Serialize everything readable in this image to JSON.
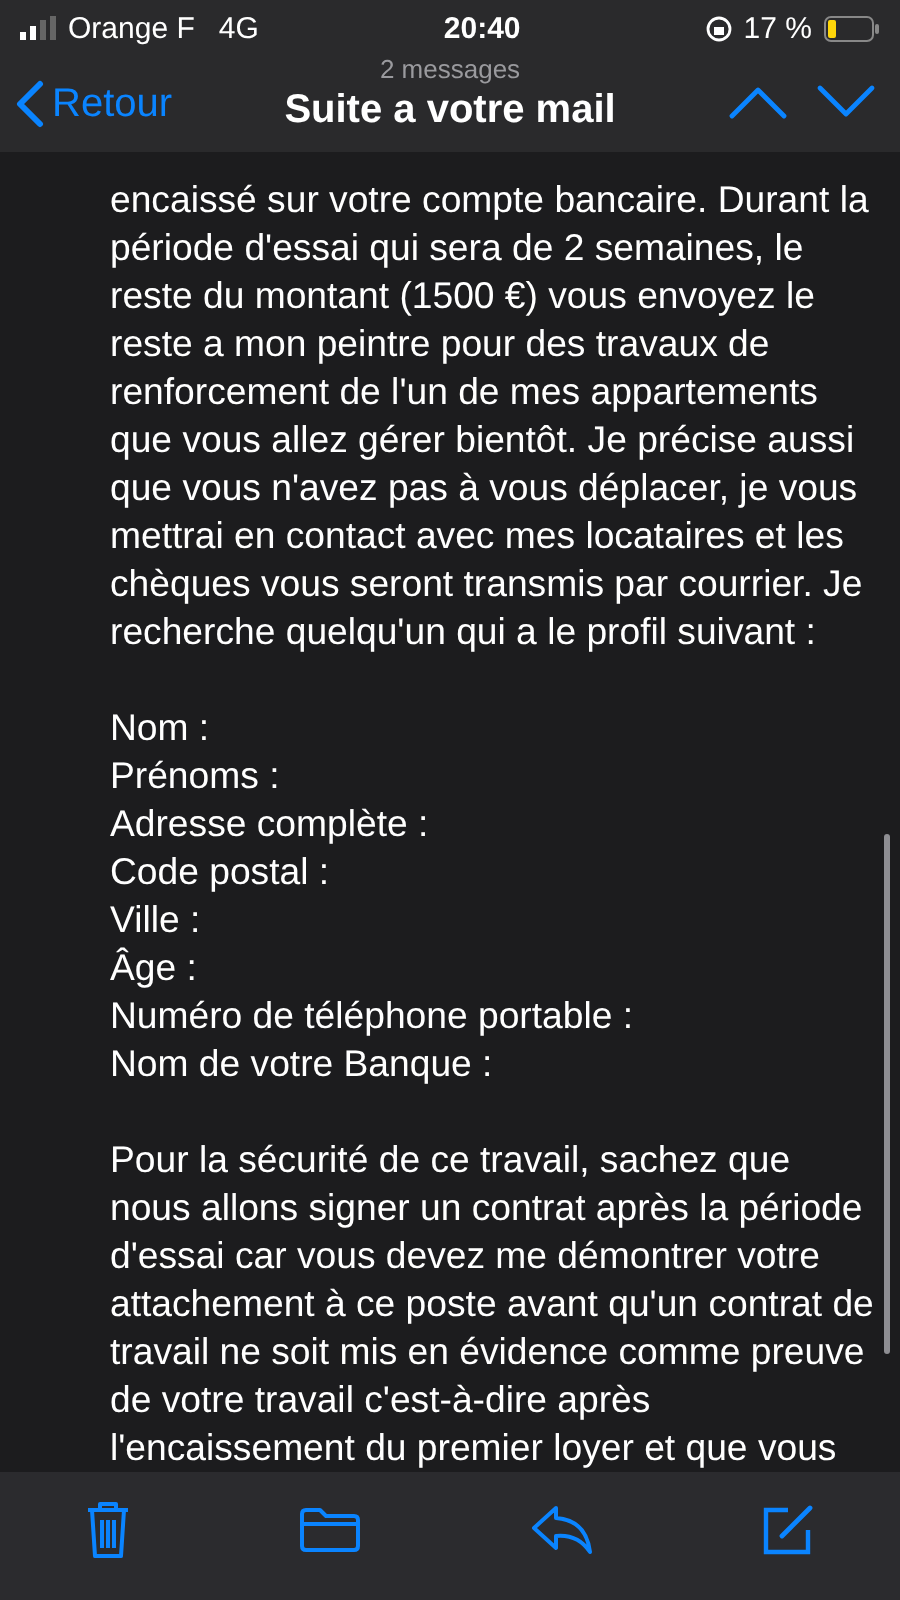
{
  "status_bar": {
    "carrier": "Orange F",
    "network": "4G",
    "time": "20:40",
    "battery": "17 %"
  },
  "header": {
    "subtitle": "2 messages",
    "title": "Suite a votre mail",
    "back": "Retour"
  },
  "body": {
    "paragraph_1": "encaissé sur votre compte bancaire. Durant la période d'essai qui sera de 2 semaines, le reste du montant (1500 €) vous envoyez le reste a mon peintre pour des travaux de renforcement de l'un de mes appartements que vous allez gérer bientôt. Je précise aussi que vous n'avez pas à vous déplacer, je vous mettrai en contact avec mes locataires et les chèques vous seront transmis par courrier. Je recherche quelqu'un qui a le profil suivant :",
    "fields": [
      "Nom :",
      "Prénoms :",
      "Adresse complète :",
      "Code postal :",
      "Ville :",
      "Âge :",
      "Numéro de téléphone portable :",
      "Nom de votre Banque :"
    ],
    "paragraph_2": "Pour la sécurité de ce travail, sachez que nous allons signer un contrat après la période d'essai car vous devez me démontrer votre attachement à ce poste avant qu'un contrat de travail ne soit mis en évidence comme preuve de votre travail c'est-à-dire après l'encaissement du premier loyer et que vous"
  }
}
